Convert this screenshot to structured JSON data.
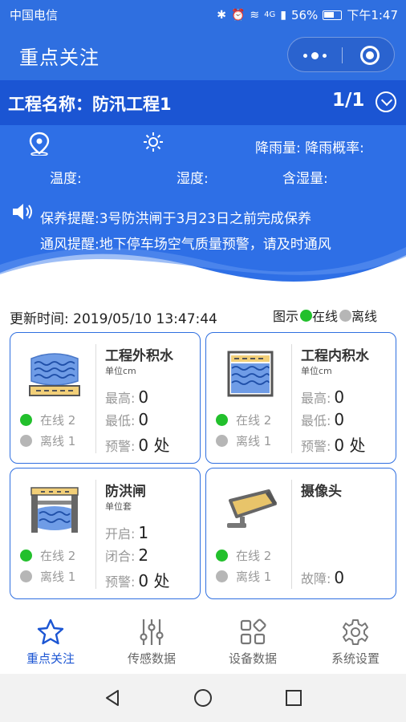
{
  "status_bar": {
    "carrier": "中国电信",
    "signal_label": "4G",
    "battery": "56%",
    "time": "下午1:47"
  },
  "titlebar": {
    "title": "重点关注"
  },
  "project": {
    "name": "工程名称：防汛工程1",
    "page": "1/1"
  },
  "weather": {
    "rain": "降雨量: 降雨概率:",
    "temperature": "温度:",
    "humidity": "湿度:",
    "moisture": "含湿量:"
  },
  "reminders": [
    "保养提醒:3号防洪闸于3月23日之前完成保养",
    "通风提醒:地下停车场空气质量预警，请及时通风"
  ],
  "update": {
    "label": "更新时间:",
    "time": "2019/05/10 13:47:44"
  },
  "legend": {
    "prefix": "图示",
    "online": "在线",
    "offline": "离线"
  },
  "cards": [
    {
      "title": "工程外积水",
      "unit": "单位cm",
      "stats": [
        {
          "label": "最高:",
          "value": "0"
        },
        {
          "label": "最低:",
          "value": "0"
        },
        {
          "label": "预警:",
          "value": "0 处"
        }
      ],
      "online": "在线 2",
      "offline": "离线 1"
    },
    {
      "title": "工程内积水",
      "unit": "单位cm",
      "stats": [
        {
          "label": "最高:",
          "value": "0"
        },
        {
          "label": "最低:",
          "value": "0"
        },
        {
          "label": "预警:",
          "value": "0 处"
        }
      ],
      "online": "在线 2",
      "offline": "离线 1"
    },
    {
      "title": "防洪闸",
      "unit": "单位套",
      "stats": [
        {
          "label": "开启:",
          "value": "1"
        },
        {
          "label": "闭合:",
          "value": "2"
        },
        {
          "label": "预警:",
          "value": "0 处"
        }
      ],
      "online": "在线 2",
      "offline": "离线 1"
    },
    {
      "title": "摄像头",
      "unit": "",
      "stats": [
        {
          "label": "故障:",
          "value": "0"
        }
      ],
      "online": "在线 2",
      "offline": "离线 1"
    }
  ],
  "tabs": [
    {
      "label": "重点关注",
      "icon": "star-icon"
    },
    {
      "label": "传感数据",
      "icon": "sliders-icon"
    },
    {
      "label": "设备数据",
      "icon": "grid-icon"
    },
    {
      "label": "系统设置",
      "icon": "gear-icon"
    }
  ],
  "colors": {
    "primary": "#2f6fe0",
    "dark_primary": "#1b55d3",
    "online": "#22c02c",
    "offline": "#b6b6b6"
  }
}
